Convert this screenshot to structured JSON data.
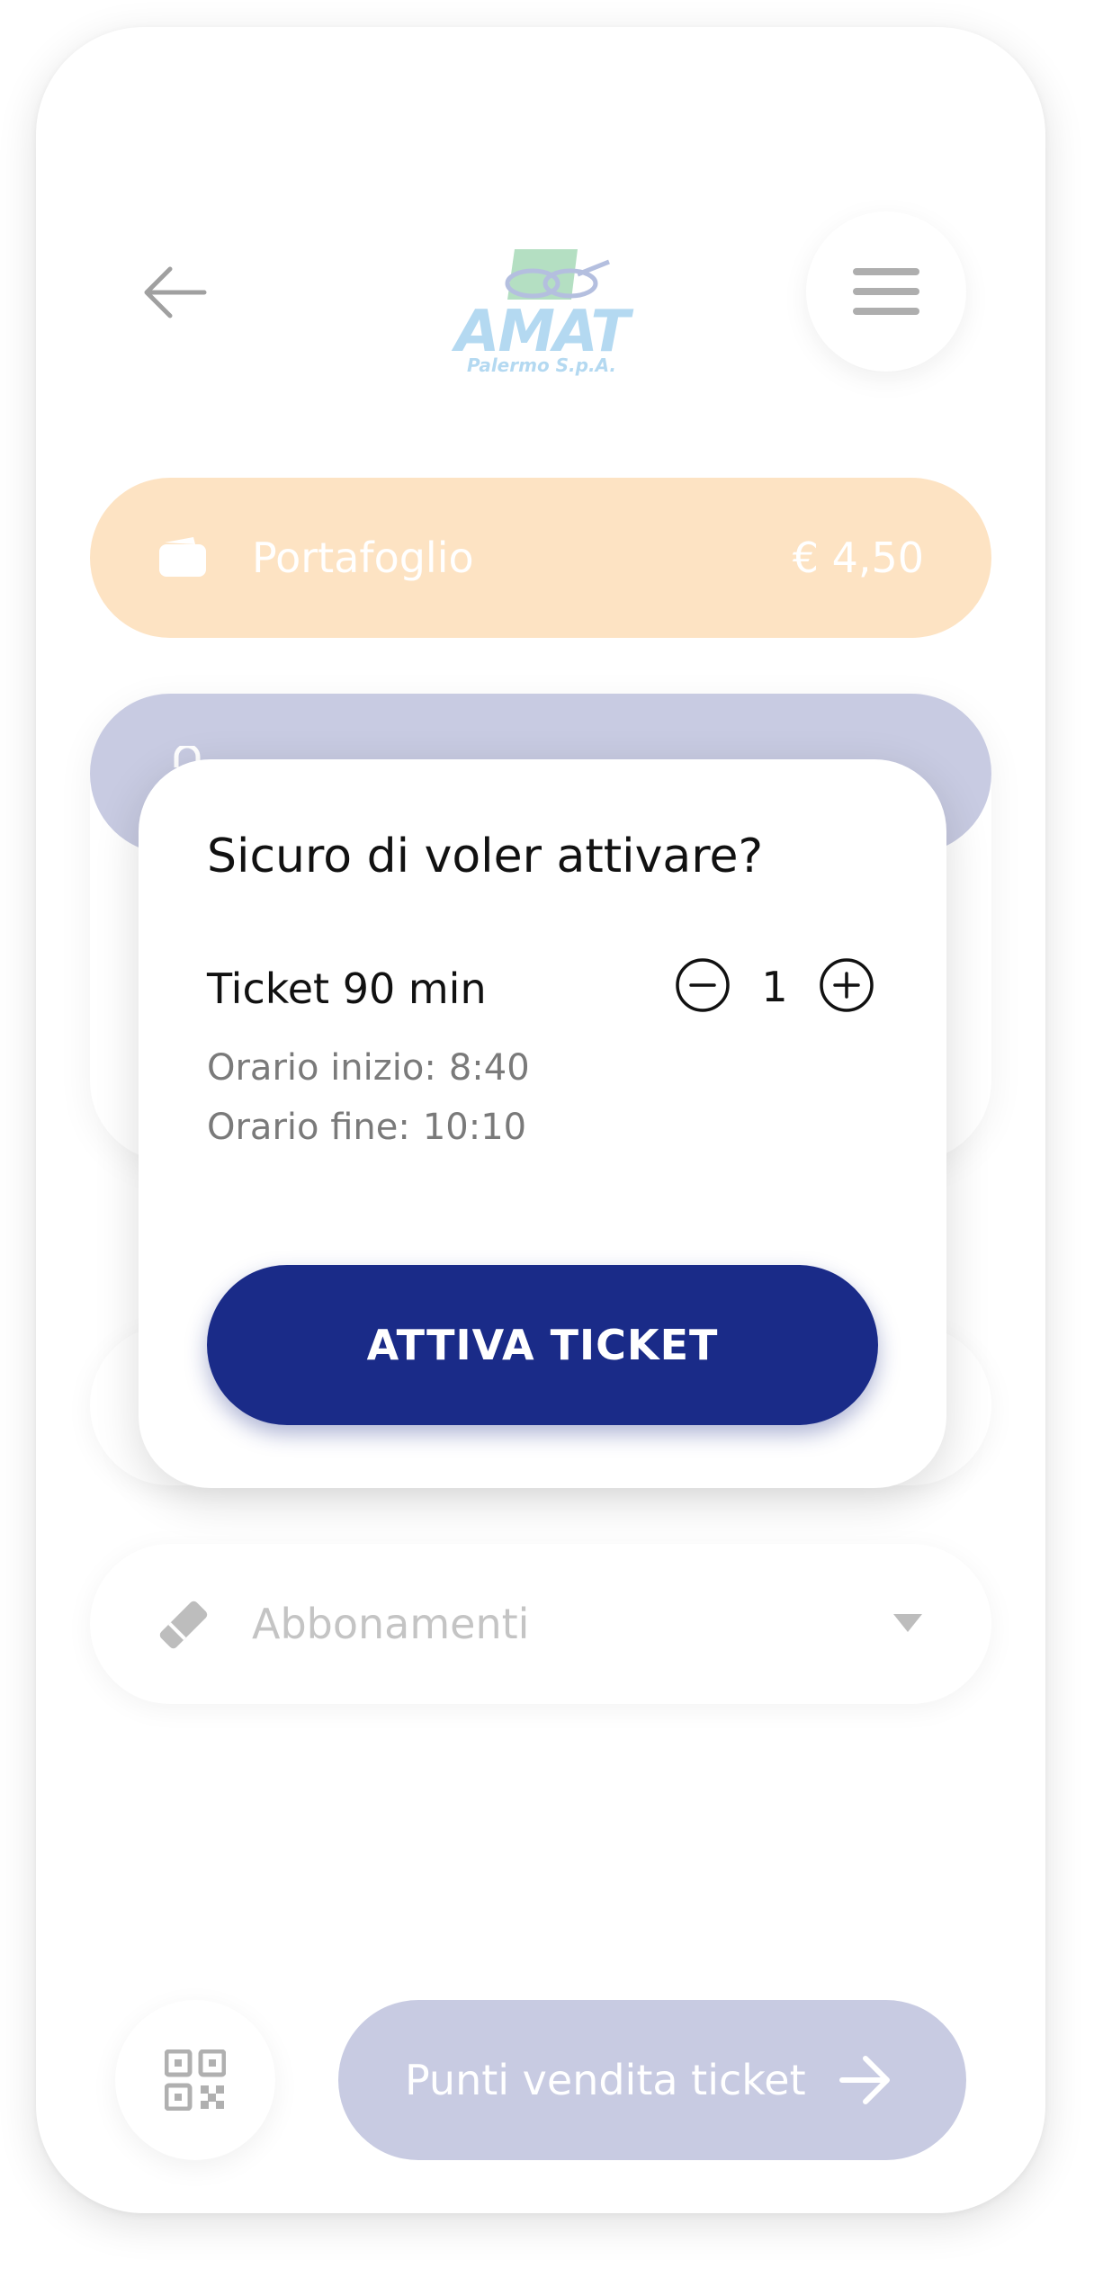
{
  "header": {
    "back_icon": "arrow-left-icon",
    "logo_text": "AMAT",
    "logo_subtitle": "Palermo S.p.A.",
    "menu_icon": "hamburger-icon"
  },
  "wallet": {
    "icon": "wallet-icon",
    "label": "Portafoglio",
    "amount": "€ 4,50"
  },
  "subscriptions": {
    "icon": "ticket-icon",
    "label": "Abbonamenti",
    "chevron": "chevron-down-icon"
  },
  "footer": {
    "qr_icon": "qr-code-icon",
    "sales_points_label": "Punti vendita ticket",
    "sales_points_icon": "arrow-right-icon"
  },
  "modal": {
    "title": "Sicuro di voler attivare?",
    "ticket_name": "Ticket 90 min",
    "quantity": "1",
    "start_label": "Orario inizio:",
    "start_value": "8:40",
    "end_label": "Orario fine:",
    "end_value": "10:10",
    "activate_label": "ATTIVA TICKET"
  },
  "colors": {
    "wallet_bg": "#fde3c3",
    "accent_light": "#c8cbe2",
    "primary": "#1a2b88"
  }
}
